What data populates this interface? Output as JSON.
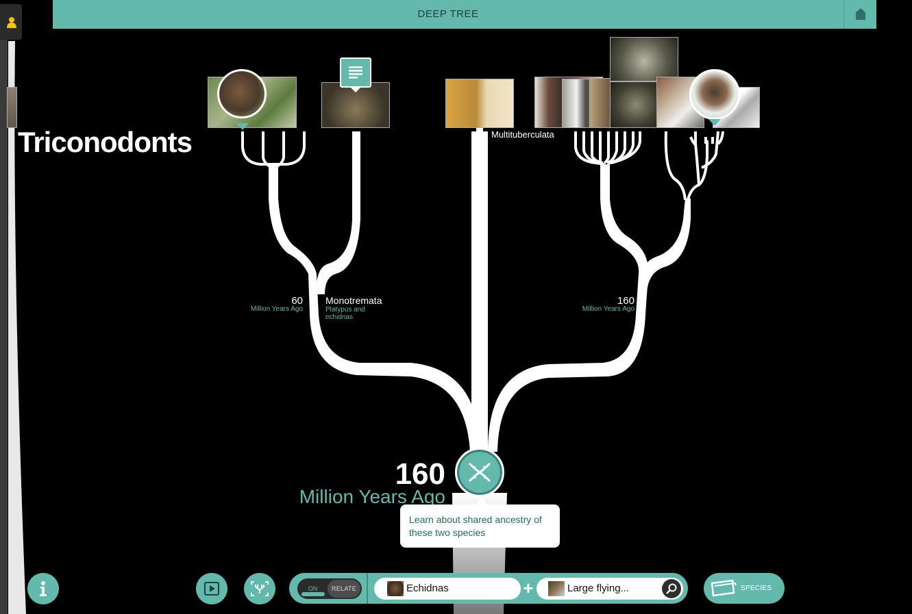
{
  "header": {
    "title": "DEEP TREE"
  },
  "tree": {
    "clade_left": "Triconodonts",
    "node_left": {
      "number": "60",
      "unit": "Million Years Ago"
    },
    "monotremata": {
      "name": "Monotremata",
      "desc": "Platypus and echidnas"
    },
    "multituberculata": "Multituberculata",
    "node_right": {
      "number": "160",
      "unit": "Million Years Ago"
    },
    "focus_node": {
      "number": "160",
      "unit": "Million Years Ago"
    }
  },
  "tooltip": {
    "text": "Learn about shared ancestry of these two species"
  },
  "toolbar": {
    "toggle_on_label": "ON",
    "toggle_relate_label": "RELATE",
    "species_a": "Echidnas",
    "species_b": "Large flying...",
    "plus": "+",
    "species_button_label": "SPECIES"
  },
  "colors": {
    "accent": "#64b9ad",
    "background": "#000000",
    "header_text": "#1f3f3b"
  }
}
